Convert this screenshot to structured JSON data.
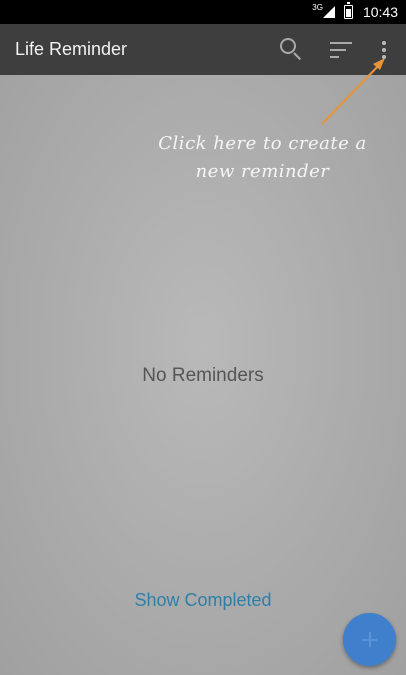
{
  "status_bar": {
    "network_label": "3G",
    "time": "10:43",
    "icons": [
      "signal-icon",
      "battery-icon"
    ]
  },
  "app_bar": {
    "title": "Life Reminder",
    "actions": [
      {
        "name": "search",
        "icon": "search-icon"
      },
      {
        "name": "sort",
        "icon": "sort-icon"
      },
      {
        "name": "more",
        "icon": "more-vertical-icon"
      }
    ]
  },
  "overlay": {
    "hint_line1": "Click here to create a",
    "hint_line2": "new reminder",
    "arrow_color": "#e8943a"
  },
  "main": {
    "empty_message": "No Reminders",
    "show_completed_label": "Show Completed"
  },
  "fab": {
    "icon": "plus-icon",
    "color": "#3f7fcc"
  },
  "colors": {
    "app_bar": "#3e3e3e",
    "status_bar": "#000000",
    "link": "#2e7fa8"
  }
}
